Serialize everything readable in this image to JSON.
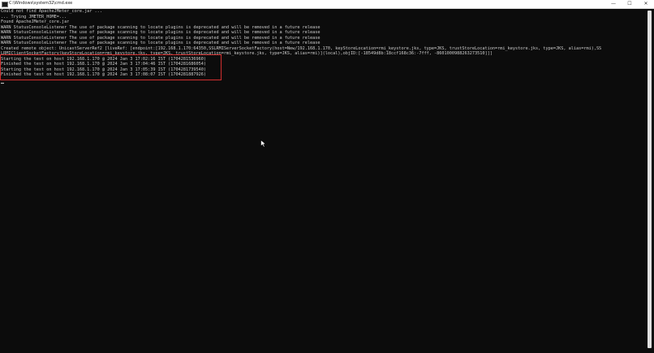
{
  "window": {
    "title": "C:\\Windows\\system32\\cmd.exe",
    "minimize": "—",
    "maximize": "☐",
    "close": "✕"
  },
  "console": {
    "lines": [
      "Could not find ApacheJMeter_core.jar ...",
      "... Trying JMETER_HOME=...",
      "Found ApacheJMeter_core.jar",
      "WARN StatusConsoleListener The use of package scanning to locate plugins is deprecated and will be removed in a future release",
      "WARN StatusConsoleListener The use of package scanning to locate plugins is deprecated and will be removed in a future release",
      "WARN StatusConsoleListener The use of package scanning to locate plugins is deprecated and will be removed in a future release",
      "WARN StatusConsoleListener The use of package scanning to locate plugins is deprecated and will be removed in a future release",
      "Created remote object: UnicastServerRef2 [liveRef: [endpoint:[192.168.1.170:64350,SSLRMIServerSocketFactory(host=New/192.168.1.170, keyStoreLocation=rmi_keystore.jks, type=JKS, trustStoreLocation=rmi_keystore.jks, type=JKS, alias=rmi),SS",
      "LRMIClientSocketFactory(keyStoreLocation=rmi_keystore.jks, type=JKS, trustStoreLocation=rmi_keystore.jks, type=JKS, alias=rmi)](local),objID:[-18549d8b:18ccf168c36:-7fff, -8601000988263273510]]]",
      "Starting the test on host 192.168.1.170 @ 2024 Jan 3 17:02:16 IST (1704281536960)",
      "Finished the test on host 192.168.1.170 @ 2024 Jan 3 17:04:46 IST (1704281686054)",
      "Starting the test on host 192.168.1.170 @ 2024 Jan 3 17:05:39 IST (1704281739540)",
      "Finished the test on host 192.168.1.170 @ 2024 Jan 3 17:08:07 IST (1704281887926)"
    ]
  }
}
